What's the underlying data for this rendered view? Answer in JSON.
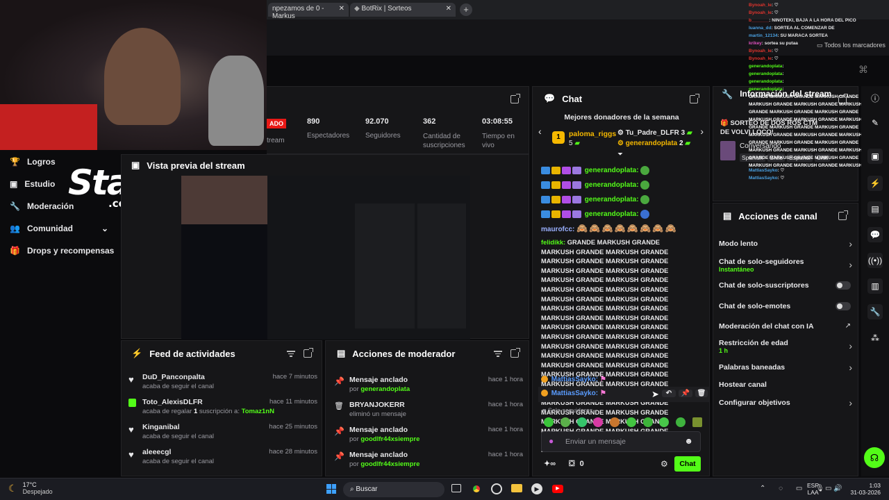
{
  "browser": {
    "tabs": [
      {
        "label": "npezamos de 0 - Markus"
      },
      {
        "label": "BotRix | Sorteos"
      }
    ],
    "bookmarks_label": "Todos los marcadores"
  },
  "stream_stats": {
    "live_badge": "ADO",
    "stream_label": "tream",
    "items": [
      {
        "value": "890",
        "label": "Espectadores"
      },
      {
        "value": "92.070",
        "label": "Seguidores"
      },
      {
        "value": "362",
        "label": "Cantidad de suscripciones"
      },
      {
        "value": "03:08:55",
        "label": "Tiempo en vivo"
      }
    ]
  },
  "sidebar": {
    "items": [
      {
        "label": "Logros"
      },
      {
        "label": "Estudio"
      },
      {
        "label": "Moderación"
      },
      {
        "label": "Comunidad"
      },
      {
        "label": "Drops y recompensas"
      }
    ]
  },
  "overlay": {
    "brand": "Stake",
    "brand_sub": ".com"
  },
  "preview": {
    "title": "Vista previa del stream"
  },
  "feed": {
    "title": "Feed de actividades",
    "items": [
      {
        "user": "DuD_Panconpalta",
        "action": "acaba de seguir el canal",
        "time": "hace 7 minutos"
      },
      {
        "user": "Toto_AlexisDLFR",
        "action_pre": "acaba de regalar ",
        "count": "1",
        "action_mid": " suscripción a: ",
        "target": "Tomaz1nN",
        "time": "hace 11 minutos"
      },
      {
        "user": "Kinganibal",
        "action": "acaba de seguir el canal",
        "time": "hace 25 minutos"
      },
      {
        "user": "aleeecgl",
        "action": "acaba de seguir el canal",
        "time": "hace 28 minutos"
      }
    ]
  },
  "modactions": {
    "title": "Acciones de moderador",
    "items": [
      {
        "title": "Mensaje anclado",
        "by": "por ",
        "user": "generandoplata",
        "time": "hace 1 hora"
      },
      {
        "title": "BRYANJOKERR",
        "by": "eliminó un mensaje",
        "user": "",
        "time": "hace 1 hora"
      },
      {
        "title": "Mensaje anclado",
        "by": "por ",
        "user": "goodlfr44xsiempre",
        "time": "hace 1 hora"
      },
      {
        "title": "Mensaje anclado",
        "by": "por ",
        "user": "goodlfr44xsiempre",
        "time": "hace 1 hora"
      }
    ]
  },
  "chat": {
    "title": "Chat",
    "donors_title": "Mejores donadores de la semana",
    "donors": [
      {
        "rank": "1",
        "name": "paloma_riggs",
        "amount": "5"
      },
      {
        "name": "Tu_Padre_DLFR",
        "amount": "3"
      },
      {
        "name": "generandoplata",
        "amount": "2"
      }
    ],
    "messages": [
      {
        "user": "generandoplata:"
      },
      {
        "user": "generandoplata:"
      },
      {
        "user": "generandoplata:"
      },
      {
        "user": "generandoplata:"
      }
    ],
    "maurofcc": "maurofcc:",
    "spam_user": "felidikk:",
    "spam_text": "GRANDE MARKUSH GRANDE MARKUSH GRANDE MARKUSH GRANDE MARKUSH GRANDE MARKUSH GRANDE MARKUSH GRANDE MARKUSH GRANDE MARKUSH GRANDE MARKUSH GRANDE MARKUSH GRANDE MARKUSH GRANDE MARKUSH GRANDE MARKUSH GRANDE MARKUSH GRANDE MARKUSH GRANDE MARKUSH GRANDE MARKUSH GRANDE MARKUSH GRANDE MARKUSH GRANDE MARKUSH GRANDE MARKUSH GRANDE MARKUSH GRANDE MARKUSH GRANDE MARKUSH GRANDE MARKUSH GRANDE MARKUSH GRANDE MARKUSH GRANDE MARKUSH GRANDE MARKUSH GRANDE MARKUSH GRANDE MARKUSH GRANDE MARKUSH GRANDE MARKUSH GRANDE MARKUSH GRANDE MARKUSH GRANDE MARKUSH GRANDE MARKUSH GRANDE MARKUSH GRANDE MARKUSH GRANDE MARKUSH GRANDE MARKUSH GRANDE MARKUSH GRANDE MARKUSH GRANDE MARKUSH GRAND",
    "sayko1": "MattiasSayko:",
    "sayko2": "MattiasSayko:",
    "followers_only": "Solo seguidores",
    "input_placeholder": "Enviar un mensaje",
    "points": "0",
    "send_label": "Chat"
  },
  "info": {
    "title": "Información del stream",
    "title_short": "stream",
    "stream_title": "SORTEO DE DOS ROS CTM DE VOLVI LOCO!",
    "category": "Conversando",
    "tags": [
      "Spanish",
      "Chile",
      "Español",
      "Chill"
    ]
  },
  "overlay_chat": [
    {
      "user": "Bynoah_le",
      "text": ": ♡"
    },
    {
      "user": "Bynoah_le",
      "text": ": ♡"
    },
    {
      "user": "b_______",
      "text": ": NINOTEKI, BAJA A LA HORA DEL PICO"
    },
    {
      "user": "luanna_dd",
      "text": ": SORTEA AL COMENZAR DE"
    },
    {
      "user": "martin_12134",
      "text": ": SU MARACA SORTEA"
    },
    {
      "user": "krikey",
      "text": ": sortea su putaa"
    },
    {
      "user": "Bynoah_le",
      "text": ": ♡"
    },
    {
      "user": "Bynoah_le",
      "text": ": ♡"
    },
    {
      "user": "generandoplata",
      "text": ":"
    },
    {
      "user": "generandoplata",
      "text": ":"
    },
    {
      "user": "generandoplata",
      "text": ":"
    },
    {
      "user": "generandoplata",
      "text": ":"
    },
    {
      "user": "MattiasSayko",
      "text": ": ♡"
    },
    {
      "user": "MattiasSayko",
      "text": ": ♡"
    }
  ],
  "channel_actions": {
    "title": "Acciones de canal",
    "items": [
      {
        "label": "Modo lento",
        "sub": "",
        "control": "chevron"
      },
      {
        "label": "Chat de solo-seguidores",
        "sub": "Instantáneo",
        "control": "chevron"
      },
      {
        "label": "Chat de solo-suscriptores",
        "sub": "",
        "control": "toggle"
      },
      {
        "label": "Chat de solo-emotes",
        "sub": "",
        "control": "toggle"
      },
      {
        "label": "Moderación del chat con IA",
        "sub": "",
        "control": "external"
      },
      {
        "label": "Restricción de edad",
        "sub": "1 h",
        "control": "chevron"
      },
      {
        "label": "Palabras baneadas",
        "sub": "",
        "control": "chevron"
      },
      {
        "label": "Hostear canal",
        "sub": "",
        "control": "none"
      },
      {
        "label": "Configurar objetivos",
        "sub": "",
        "control": "chevron"
      }
    ]
  },
  "taskbar": {
    "weather_temp": "17°C",
    "weather_text": "Despejado",
    "search_label": "Buscar",
    "lang": "ESP",
    "lang_sub": "LAA",
    "time": "1:03",
    "date": "31-03-2026"
  },
  "colors": {
    "accent": "#53fc18",
    "bg": "#0b0b0d",
    "panel": "#161618"
  }
}
